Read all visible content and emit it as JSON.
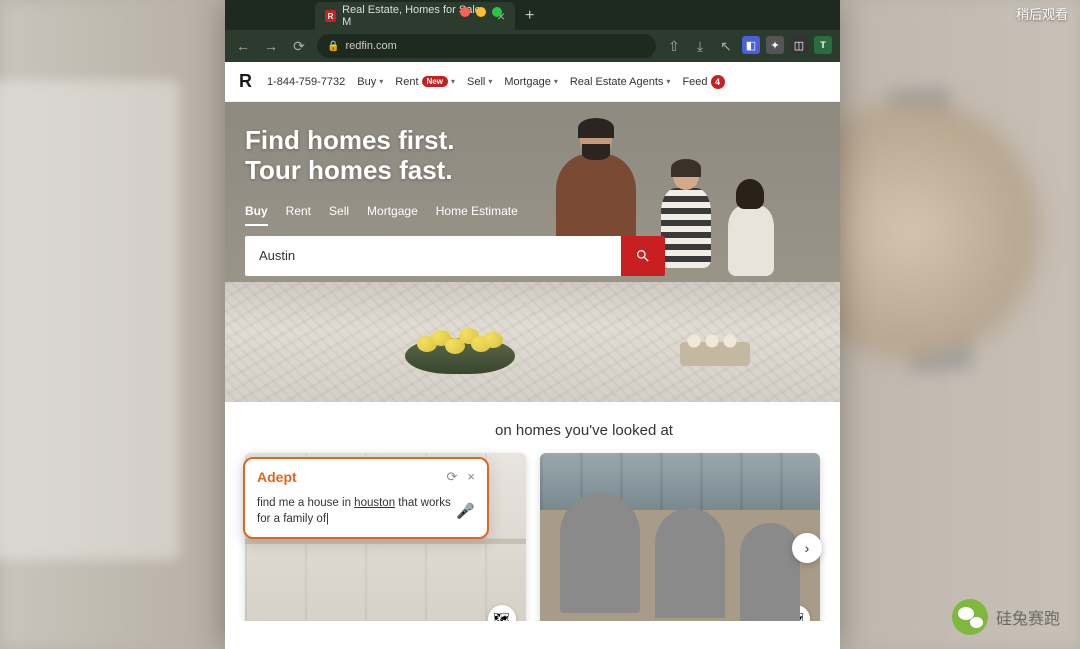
{
  "overlay": {
    "top_right": "稍后观看",
    "wechat_name": "硅兔赛跑"
  },
  "browser": {
    "tab_title": "Real Estate, Homes for Sale, M",
    "url": "redfin.com"
  },
  "nav": {
    "phone": "1-844-759-7732",
    "buy": "Buy",
    "rent": "Rent",
    "rent_badge": "New",
    "sell": "Sell",
    "mortgage": "Mortgage",
    "agents": "Real Estate Agents",
    "feed": "Feed",
    "feed_count": "4"
  },
  "hero": {
    "line1": "Find homes first.",
    "line2": "Tour homes fast.",
    "tabs": {
      "buy": "Buy",
      "rent": "Rent",
      "sell": "Sell",
      "mortgage": "Mortgage",
      "estimate": "Home Estimate"
    },
    "search_value": "Austin"
  },
  "feed": {
    "heading_suffix": "on homes you've looked at"
  },
  "adept": {
    "brand": "Adept",
    "text_pre": "find me a house in ",
    "text_underline": "houston",
    "text_post": " that works for a family of"
  }
}
